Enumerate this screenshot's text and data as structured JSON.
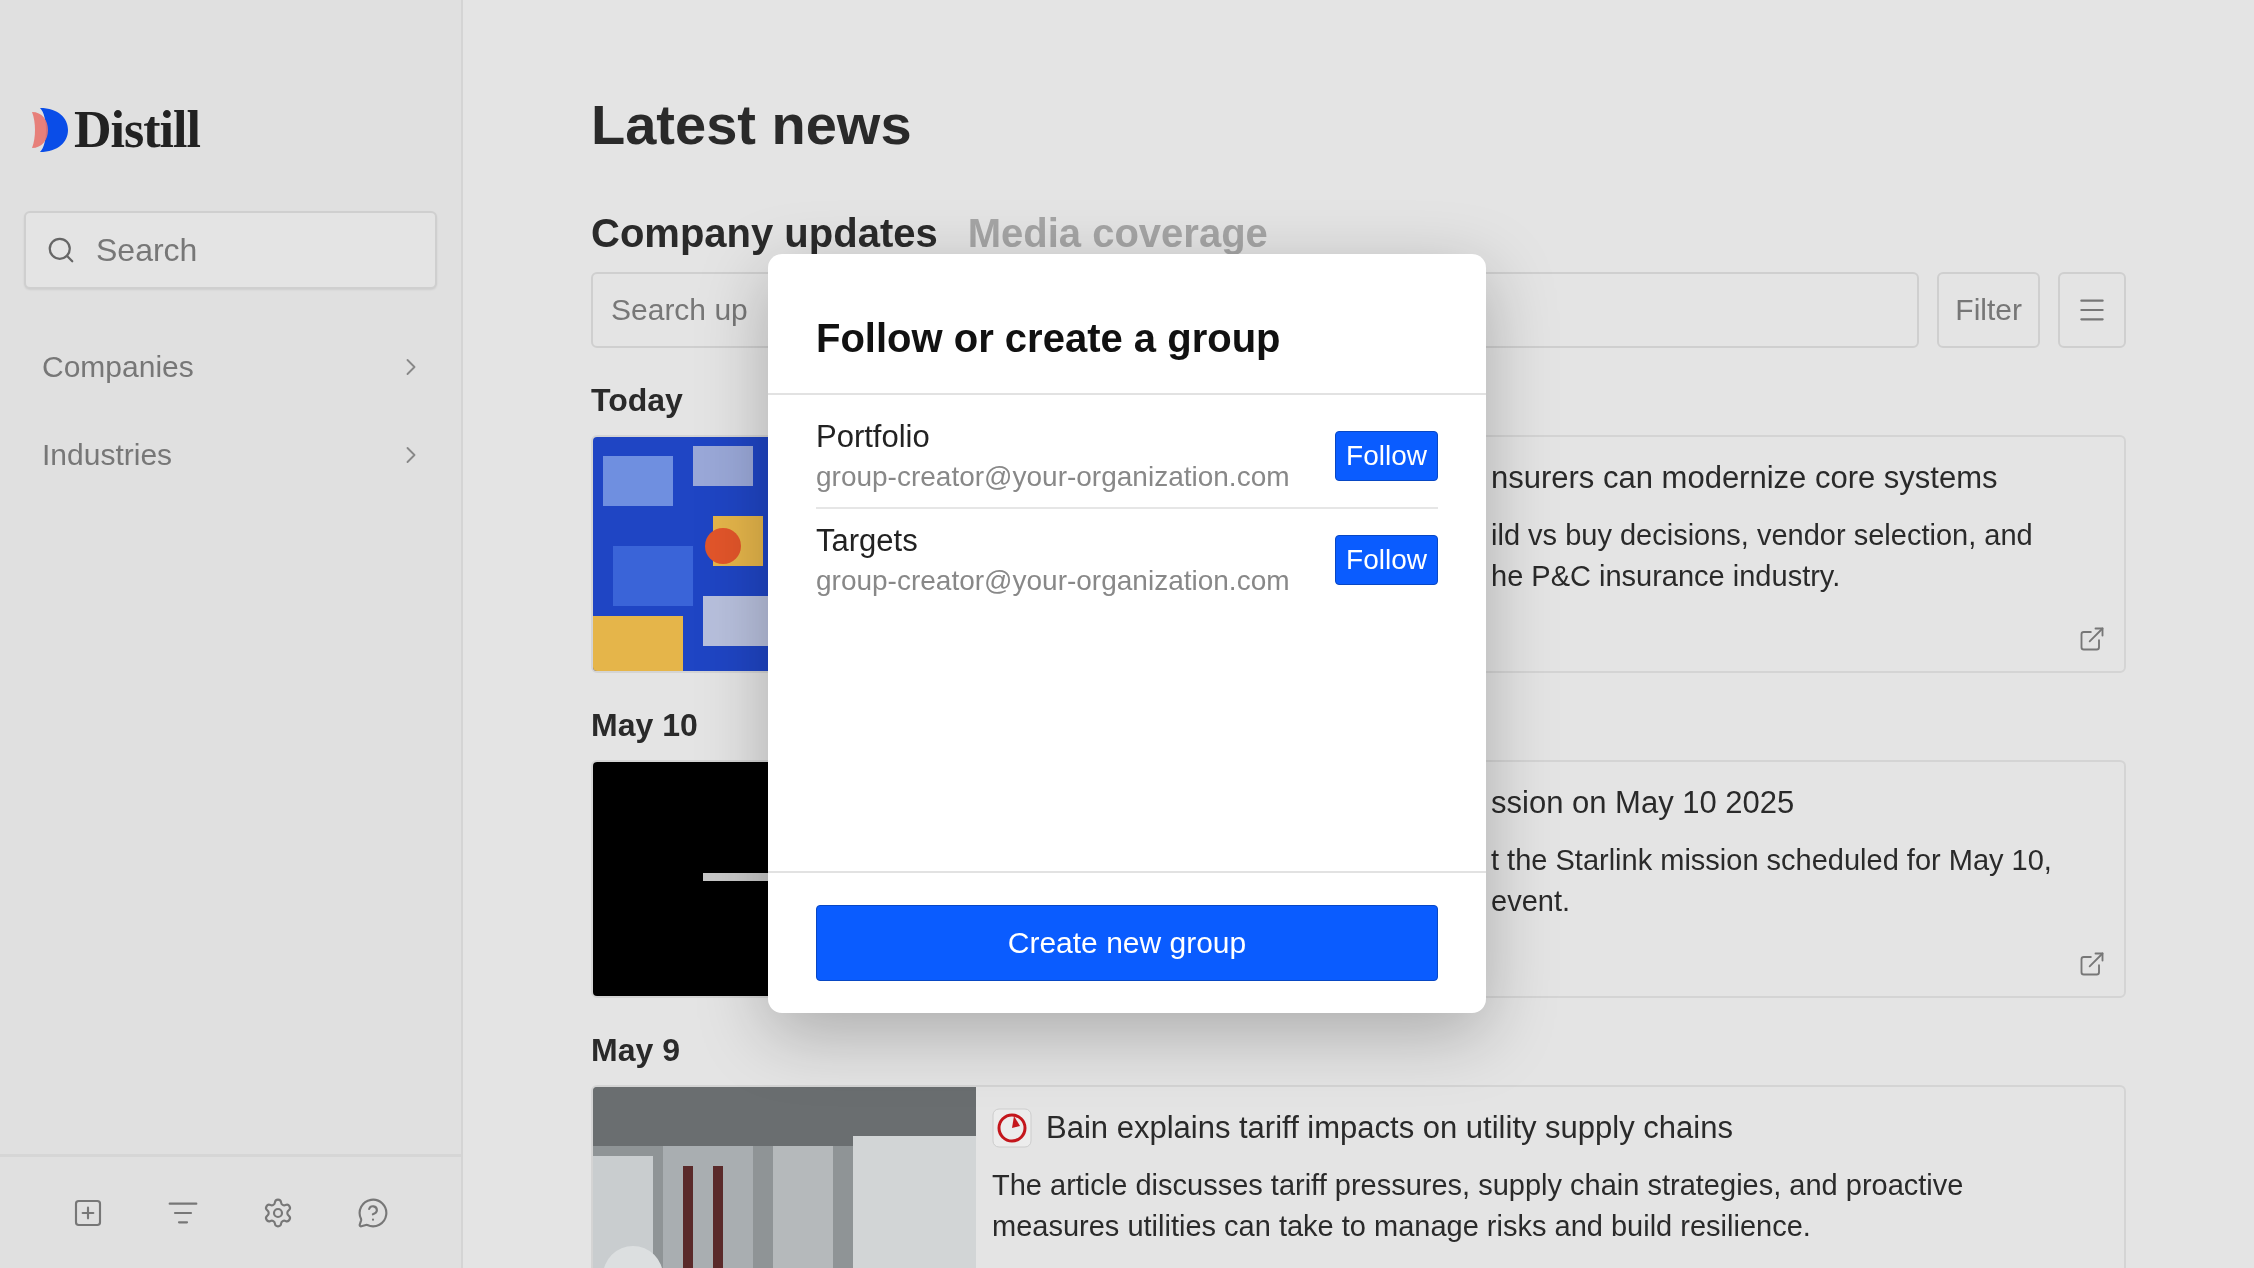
{
  "sidebar": {
    "logo": "Distill",
    "search": {
      "placeholder": "Search"
    },
    "items": [
      {
        "label": "Companies"
      },
      {
        "label": "Industries"
      }
    ]
  },
  "main": {
    "title": "Latest news",
    "tabs": [
      {
        "label": "Company updates",
        "selected": true
      },
      {
        "label": "Media coverage",
        "selected": false
      }
    ],
    "search": {
      "placeholder": "Search up"
    },
    "filter_button": "Filter",
    "sections": [
      {
        "date": "Today",
        "articles": [
          {
            "kind": "covered",
            "title": "nsurers can modernize core systems",
            "summary_lines": [
              "ild vs buy decisions, vendor selection, and",
              "he P&C insurance industry."
            ]
          }
        ]
      },
      {
        "date": "May 10",
        "articles": [
          {
            "kind": "covered",
            "title": "ssion on May 10 2025",
            "summary_lines": [
              "t the Starlink mission scheduled for May 10,",
              "event."
            ]
          }
        ]
      },
      {
        "date": "May 9",
        "articles": [
          {
            "kind": "full",
            "title": "Bain explains tariff impacts on utility supply chains",
            "summary": "The article discusses tariff pressures, supply chain strategies, and proactive measures utilities can take to manage risks and build resilience."
          }
        ]
      }
    ]
  },
  "modal": {
    "title": "Follow or create a group",
    "groups": [
      {
        "name": "Portfolio",
        "creator": "group-creator@your-organization.com",
        "button": "Follow"
      },
      {
        "name": "Targets",
        "creator": "group-creator@your-organization.com",
        "button": "Follow"
      }
    ],
    "create_button": "Create new group"
  }
}
